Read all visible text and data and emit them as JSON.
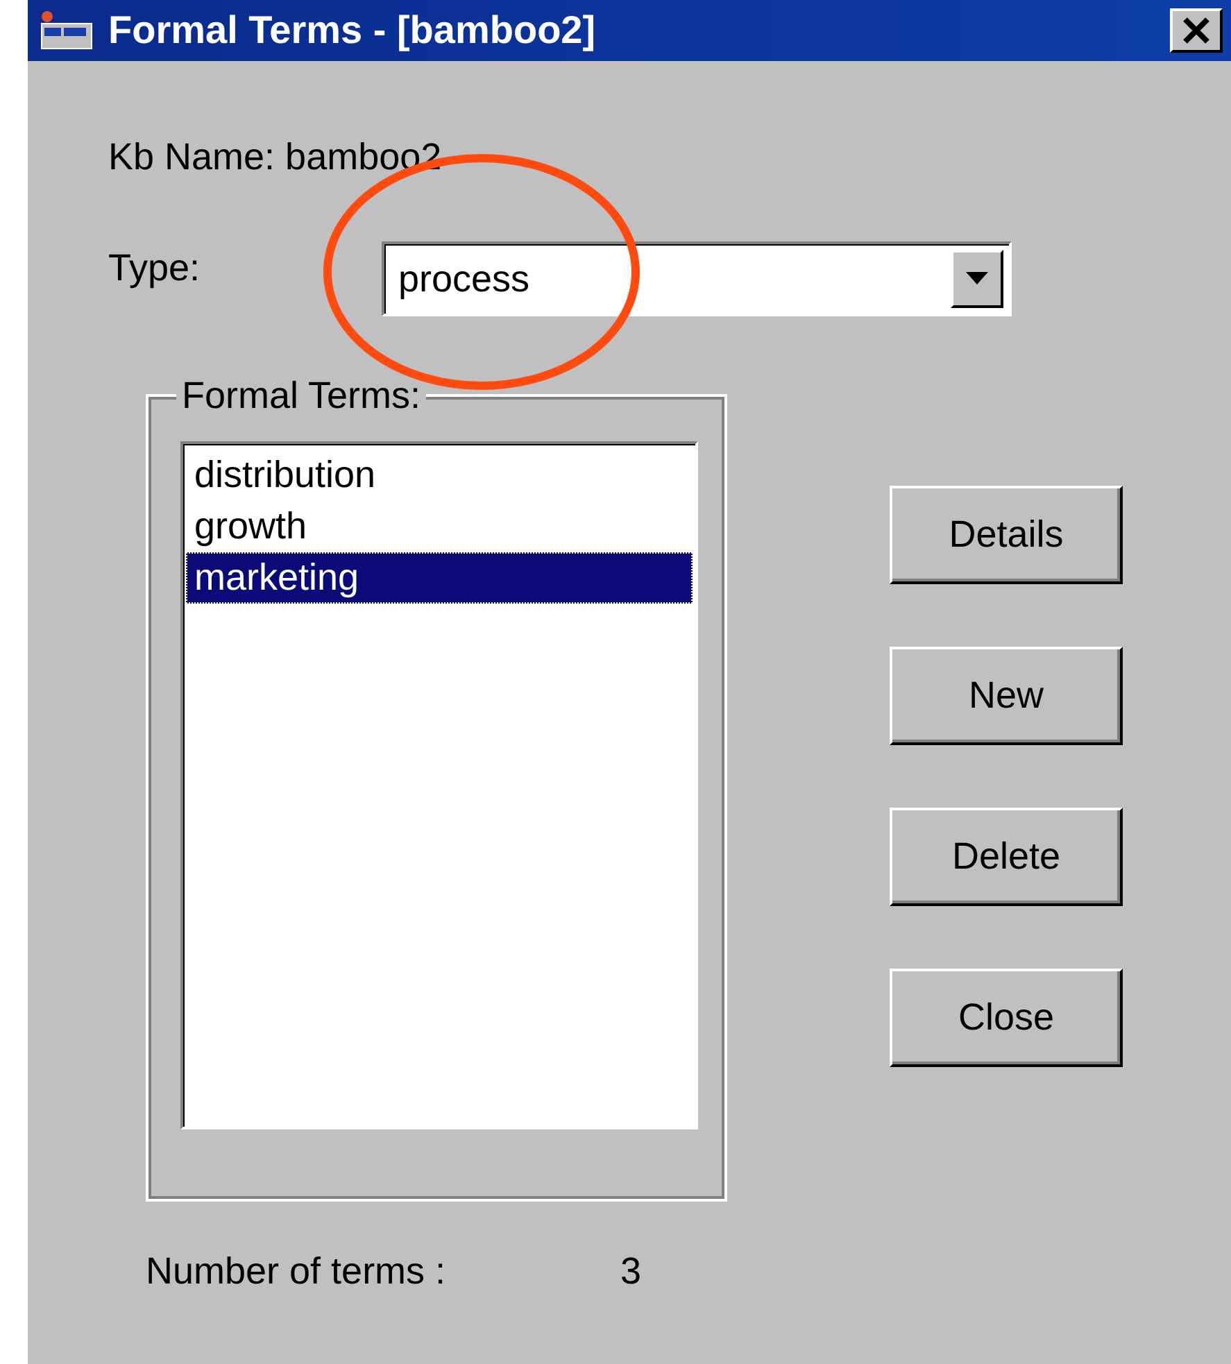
{
  "window": {
    "title": "Formal Terms - [bamboo2]"
  },
  "kb_name": "Kb Name: bamboo2",
  "type": {
    "label": "Type:",
    "value": "process"
  },
  "formal_terms": {
    "label": "Formal Terms:",
    "items": [
      {
        "text": "distribution",
        "selected": false
      },
      {
        "text": "growth",
        "selected": false
      },
      {
        "text": "marketing",
        "selected": true
      }
    ]
  },
  "buttons": [
    "Details",
    "New",
    "Delete",
    "Close"
  ],
  "count": {
    "label": "Number of terms :",
    "value": "3"
  }
}
